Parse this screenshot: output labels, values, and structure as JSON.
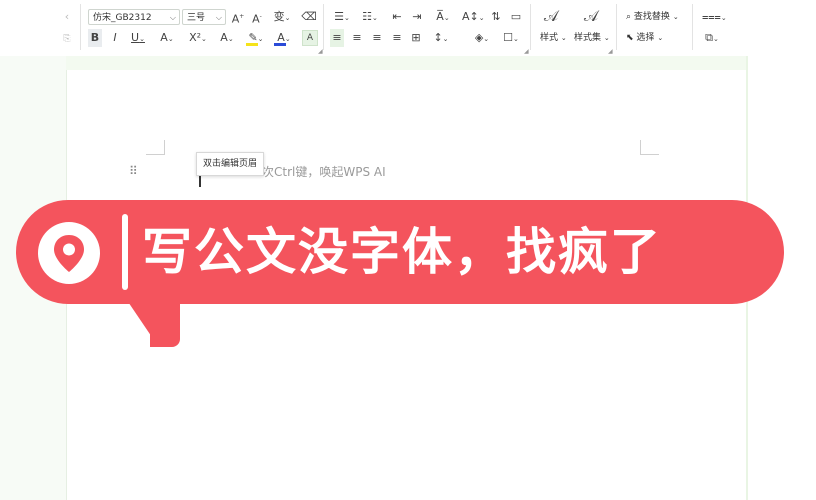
{
  "toolbar": {
    "font_name": "仿宋_GB2312",
    "font_size": "三号",
    "style_label": "样式",
    "style_set_label": "样式集",
    "find_replace_label": "查找替换",
    "select_label": "选择"
  },
  "document": {
    "header_tooltip": "双击编辑页眉",
    "ai_hint": "次Ctrl键，唤起WPS AI"
  },
  "banner": {
    "text": "写公文没字体，找疯了",
    "color": "#f4545d"
  },
  "colors": {
    "font_color_bar": "#2b4bd8",
    "highlight_bar": "#f5e31a",
    "ribbon_bg": "#ffffff"
  }
}
